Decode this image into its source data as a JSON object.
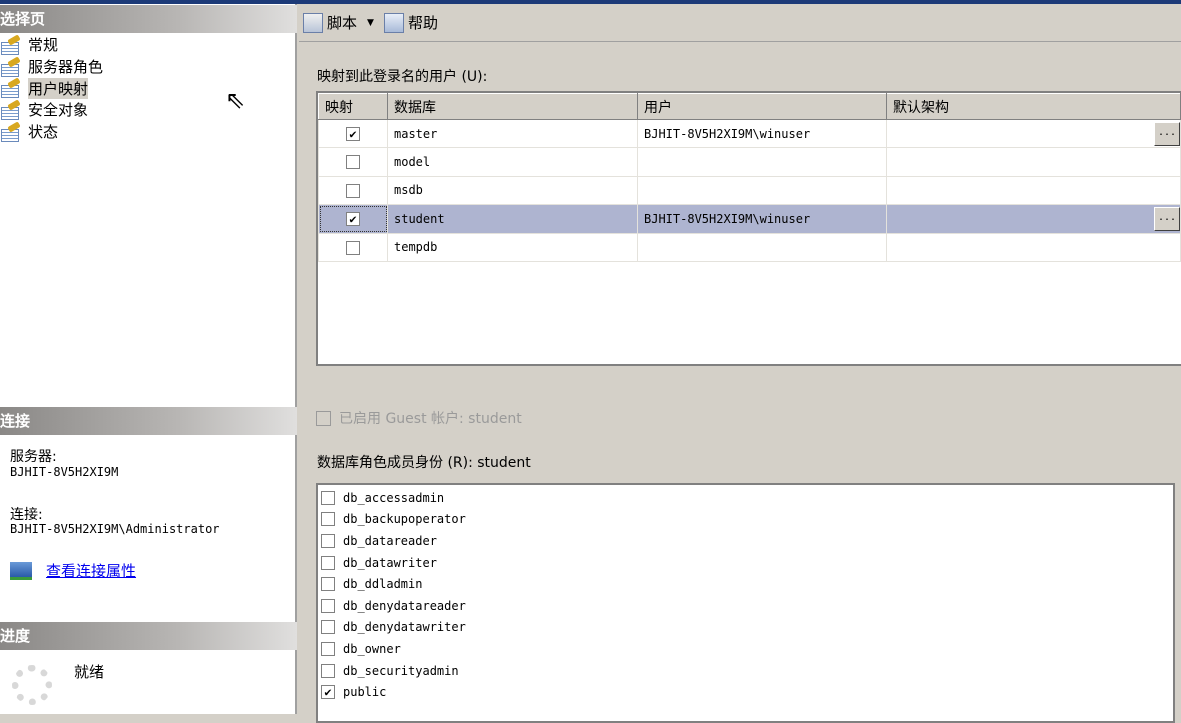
{
  "left": {
    "select_page_header": "选择页",
    "nav_items": [
      {
        "label": "常规"
      },
      {
        "label": "服务器角色"
      },
      {
        "label": "用户映射",
        "selected": true
      },
      {
        "label": "安全对象"
      },
      {
        "label": "状态"
      }
    ],
    "connection_header": "连接",
    "server_label": "服务器:",
    "server_value": "BJHIT-8V5H2XI9M",
    "connection_label": "连接:",
    "connection_value": "BJHIT-8V5H2XI9M\\Administrator",
    "view_properties_link": "查看连接属性",
    "progress_header": "进度",
    "progress_status": "就绪"
  },
  "toolbar": {
    "script_label": "脚本",
    "help_label": "帮助"
  },
  "mapping": {
    "label": "映射到此登录名的用户 (U):",
    "columns": [
      "映射",
      "数据库",
      "用户",
      "默认架构"
    ],
    "rows": [
      {
        "mapped": true,
        "database": "master",
        "user": "BJHIT-8V5H2XI9M\\winuser",
        "schema": "",
        "browse": "..."
      },
      {
        "mapped": false,
        "database": "model",
        "user": "",
        "schema": ""
      },
      {
        "mapped": false,
        "database": "msdb",
        "user": "",
        "schema": ""
      },
      {
        "mapped": true,
        "database": "student",
        "user": "BJHIT-8V5H2XI9M\\winuser",
        "schema": "",
        "browse": "...",
        "selected": true
      },
      {
        "mapped": false,
        "database": "tempdb",
        "user": "",
        "schema": ""
      }
    ]
  },
  "guest": {
    "label": "已启用 Guest 帐户: student",
    "checked": false
  },
  "roles": {
    "label": "数据库角色成员身份 (R): student",
    "items": [
      {
        "name": "db_accessadmin",
        "checked": false
      },
      {
        "name": "db_backupoperator",
        "checked": false
      },
      {
        "name": "db_datareader",
        "checked": false
      },
      {
        "name": "db_datawriter",
        "checked": false
      },
      {
        "name": "db_ddladmin",
        "checked": false
      },
      {
        "name": "db_denydatareader",
        "checked": false
      },
      {
        "name": "db_denydatawriter",
        "checked": false
      },
      {
        "name": "db_owner",
        "checked": false
      },
      {
        "name": "db_securityadmin",
        "checked": false
      },
      {
        "name": "public",
        "checked": true
      }
    ]
  }
}
